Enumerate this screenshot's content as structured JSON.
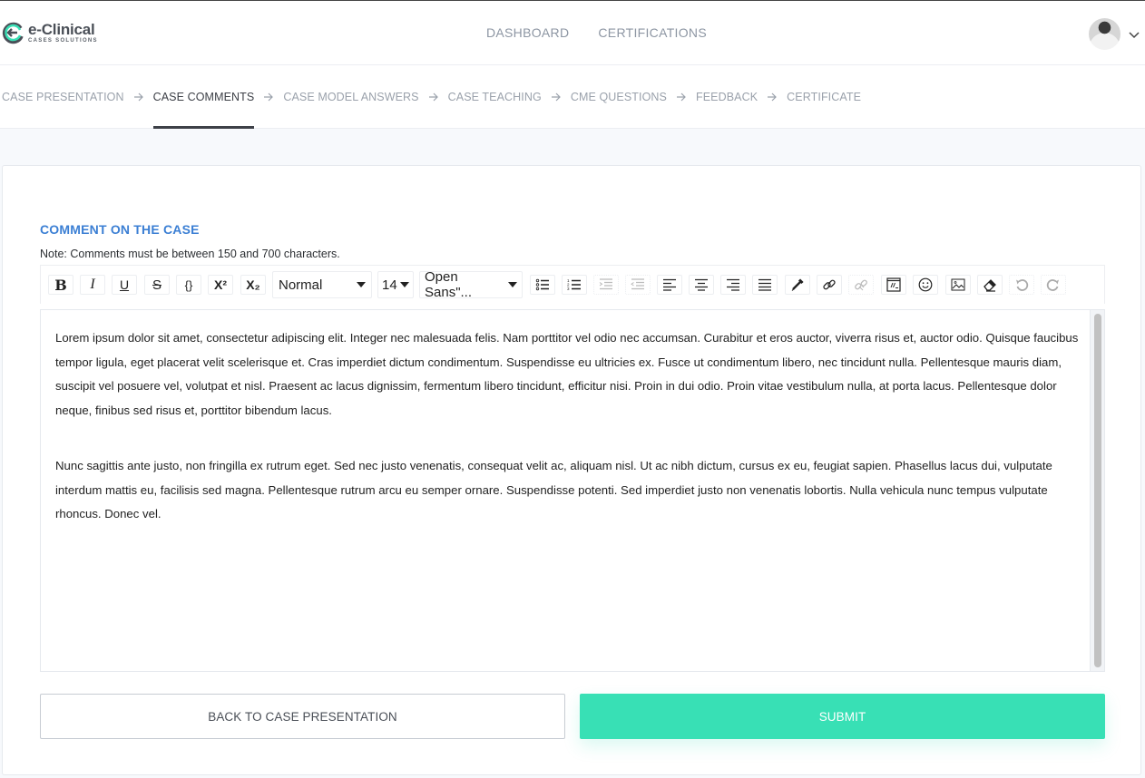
{
  "brand": {
    "name": "e-Clinical",
    "tagline": "CASES SOLUTIONS",
    "accent": "#38e0b5",
    "logo_color": "#4a4f57"
  },
  "header": {
    "nav": [
      {
        "label": "DASHBOARD"
      },
      {
        "label": "CERTIFICATIONS"
      }
    ],
    "profile": {
      "avatar": "avatar-photo",
      "menu_icon": "chevron-down-icon"
    }
  },
  "steps": [
    {
      "label": "CASE PRESENTATION",
      "active": false
    },
    {
      "label": "CASE COMMENTS",
      "active": true
    },
    {
      "label": "CASE MODEL ANSWERS",
      "active": false
    },
    {
      "label": "CASE TEACHING",
      "active": false
    },
    {
      "label": "CME QUESTIONS",
      "active": false
    },
    {
      "label": "FEEDBACK",
      "active": false
    },
    {
      "label": "CERTIFICATE",
      "active": false
    }
  ],
  "form": {
    "title": "COMMENT ON THE CASE",
    "title_color": "#3b7fd4",
    "note": "Note: Comments must be between 150 and 700 characters.",
    "toolbar": {
      "buttons": [
        {
          "name": "bold",
          "label": "B"
        },
        {
          "name": "italic",
          "label": "I"
        },
        {
          "name": "underline",
          "label": "U"
        },
        {
          "name": "strikethrough",
          "label": "S"
        },
        {
          "name": "code",
          "label": "{}"
        },
        {
          "name": "superscript",
          "label": "X²"
        },
        {
          "name": "subscript",
          "label": "X₂"
        }
      ],
      "block_format": "Normal",
      "font_size": "14",
      "font_family": "Open Sans\"...",
      "icons": [
        "unordered-list",
        "ordered-list",
        "indent",
        "outdent",
        "align-left",
        "align-center",
        "align-right",
        "justify",
        "color-picker",
        "link",
        "unlink",
        "embed",
        "emoji",
        "image",
        "remove-format",
        "undo",
        "redo"
      ]
    },
    "content": [
      "Lorem ipsum dolor sit amet, consectetur adipiscing elit. Integer nec malesuada felis. Nam porttitor vel odio nec accumsan. Curabitur et eros auctor, viverra risus et, auctor odio. Quisque faucibus tempor ligula, eget placerat velit scelerisque et. Cras imperdiet dictum condimentum. Suspendisse eu ultricies ex. Fusce ut condimentum libero, nec tincidunt nulla. Pellentesque mauris diam, suscipit vel posuere vel, volutpat et nisl. Praesent ac lacus dignissim, fermentum libero tincidunt, efficitur nisi. Proin in dui odio. Proin vitae vestibulum nulla, at porta lacus. Pellentesque dolor neque, finibus sed risus et, porttitor bibendum lacus.",
      "Nunc sagittis ante justo, non fringilla ex rutrum eget. Sed nec justo venenatis, consequat velit ac, aliquam nisl. Ut ac nibh dictum, cursus ex eu, feugiat sapien. Phasellus lacus dui, vulputate interdum mattis eu, facilisis sed magna. Pellentesque rutrum arcu eu semper ornare. Suspendisse potenti. Sed imperdiet justo non venenatis lobortis. Nulla vehicula nunc tempus vulputate rhoncus. Donec vel."
    ],
    "back_label": "BACK TO CASE PRESENTATION",
    "submit_label": "SUBMIT"
  }
}
